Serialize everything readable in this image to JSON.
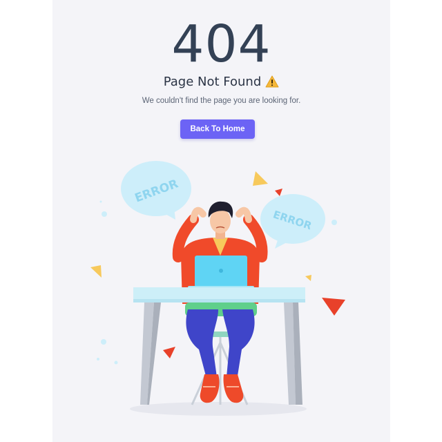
{
  "error": {
    "code": "404",
    "title": "Page Not Found",
    "title_icon": "warning-icon",
    "message": "We couldn't find the page you are looking for."
  },
  "actions": {
    "back_home_label": "Back To Home"
  },
  "illustration": {
    "bubble_left_text": "ERROR",
    "bubble_right_text": "ERROR"
  },
  "colors": {
    "page_background": "#f4f4f8",
    "heading": "#334155",
    "button": "#6c63f5",
    "button_text": "#ffffff",
    "bubble": "#cdeefa",
    "bubble_text": "#8fd5ef",
    "shirt": "#f04a2a",
    "pants": "#3f45c9",
    "laptop": "#5fd4f4",
    "desk_top": "#cdeff8",
    "accent_red": "#e8412a",
    "accent_yellow": "#f7c95c"
  }
}
